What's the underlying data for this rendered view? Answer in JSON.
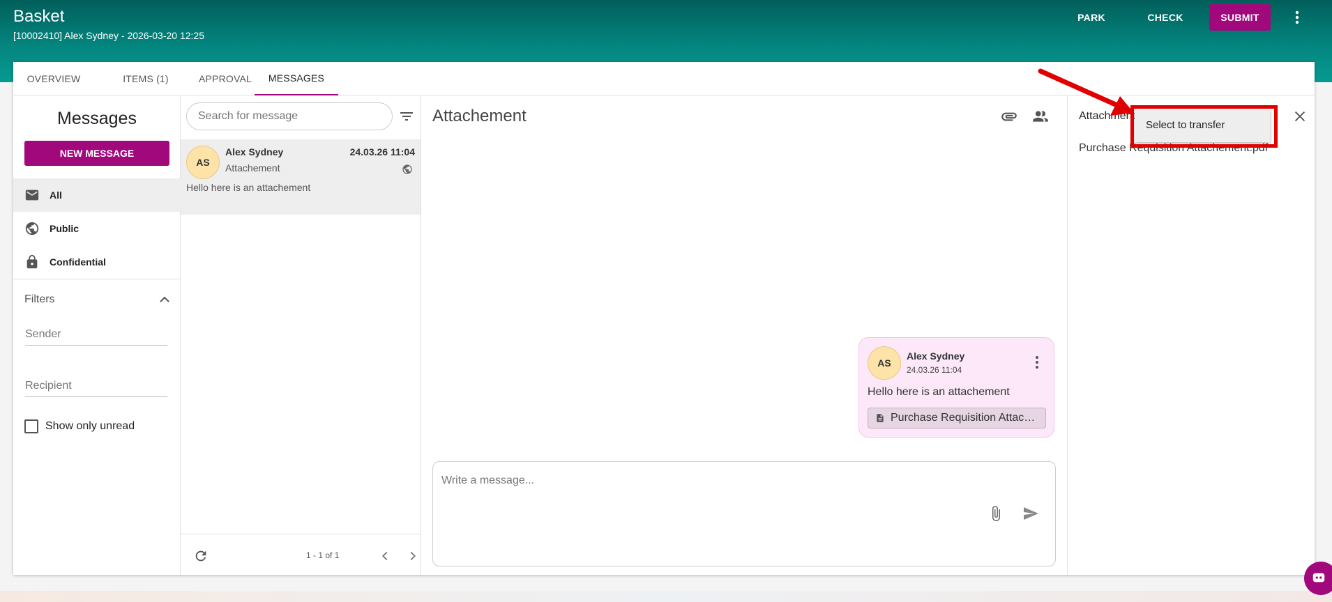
{
  "header": {
    "title": "Basket",
    "subtitle": "[10002410] Alex Sydney - 2026-03-20 12:25",
    "park_label": "PARK",
    "check_label": "CHECK",
    "submit_label": "SUBMIT"
  },
  "tabs": [
    {
      "label": "OVERVIEW"
    },
    {
      "label": "ITEMS (1)"
    },
    {
      "label": "APPROVAL"
    },
    {
      "label": "MESSAGES",
      "active": true
    }
  ],
  "sidebar": {
    "title": "Messages",
    "new_message_label": "NEW MESSAGE",
    "items": [
      {
        "label": "All",
        "icon": "mail-icon",
        "active": true
      },
      {
        "label": "Public",
        "icon": "globe-icon"
      },
      {
        "label": "Confidential",
        "icon": "lock-icon"
      }
    ],
    "filters": {
      "title": "Filters",
      "sender_placeholder": "Sender",
      "recipient_placeholder": "Recipient",
      "show_only_unread_label": "Show only unread",
      "show_only_unread_checked": false
    }
  },
  "message_list": {
    "search_placeholder": "Search for message",
    "items": [
      {
        "initials": "AS",
        "sender": "Alex Sydney",
        "subject": "Attachement",
        "date": "24.03.26 11:04",
        "preview": "Hello here is an attachement"
      }
    ],
    "pager": "1 - 1 of 1"
  },
  "conversation": {
    "title": "Attachement",
    "message": {
      "initials": "AS",
      "sender": "Alex Sydney",
      "date": "24.03.26 11:04",
      "text": "Hello here is an attachement",
      "attachment": "Purchase Requisition Attachement.pdf"
    },
    "compose_placeholder": "Write a message..."
  },
  "attachments_panel": {
    "title": "Attachments",
    "files": [
      "Purchase Requisition Attachement.pdf"
    ]
  },
  "context_menu": {
    "item_label": "Select to transfer"
  },
  "colors": {
    "accent": "#a0087c",
    "header_dark": "#025e5a",
    "header_light": "#079a91",
    "annotation": "#e00000"
  }
}
